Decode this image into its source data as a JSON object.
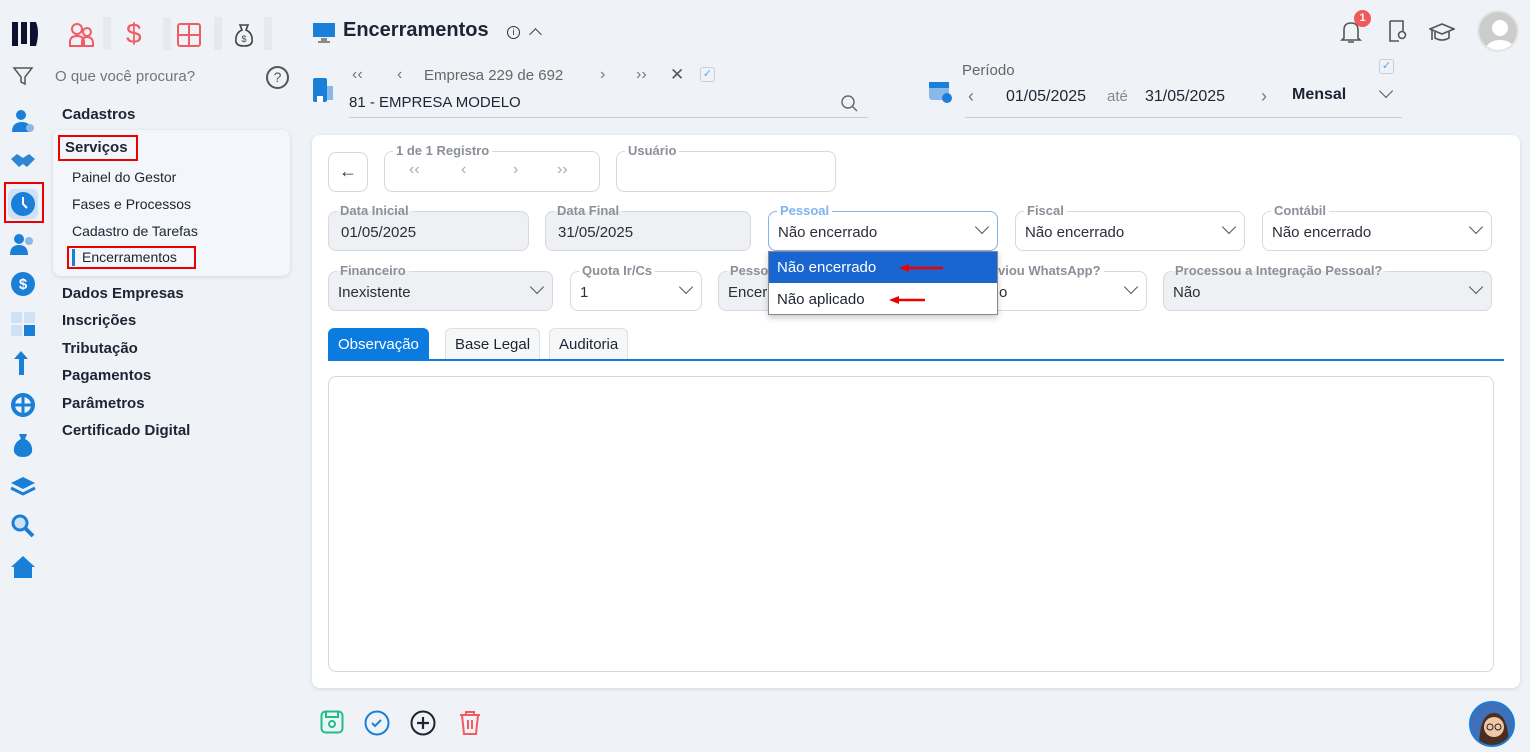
{
  "logo": "M",
  "top_shortcuts": [
    "people-icon",
    "dollar-icon",
    "calculator-icon",
    "money-bag-icon"
  ],
  "search": {
    "placeholder": "O que você procura?"
  },
  "menu": {
    "cadastros": "Cadastros",
    "servicos": "Serviços",
    "servicos_items": [
      "Painel do Gestor",
      "Fases e Processos",
      "Cadastro de Tarefas",
      "Encerramentos"
    ],
    "others": [
      "Dados Empresas",
      "Inscrições",
      "Tributação",
      "Pagamentos",
      "Parâmetros",
      "Certificado Digital"
    ]
  },
  "header": {
    "title": "Encerramentos",
    "notification_count": "1"
  },
  "empresa": {
    "nav_text": "Empresa 229 de 692",
    "value": "81 - EMPRESA MODELO"
  },
  "periodo": {
    "label": "Período",
    "start": "01/05/2025",
    "sep": "até",
    "end": "31/05/2025",
    "mode": "Mensal"
  },
  "record": {
    "label": "1 de 1 Registro",
    "user_label": "Usuário",
    "user_value": ""
  },
  "fields": {
    "data_inicial": {
      "label": "Data Inicial",
      "value": "01/05/2025"
    },
    "data_final": {
      "label": "Data Final",
      "value": "31/05/2025"
    },
    "pessoal": {
      "label": "Pessoal",
      "value": "Não encerrado"
    },
    "fiscal": {
      "label": "Fiscal",
      "value": "Não encerrado"
    },
    "contabil": {
      "label": "Contábil",
      "value": "Não encerrado"
    },
    "financeiro": {
      "label": "Financeiro",
      "value": "Inexistente"
    },
    "quota": {
      "label": "Quota Ir/Cs",
      "value": "1"
    },
    "hidden1": {
      "label": "Pesso",
      "value": "Encer"
    },
    "whatsapp": {
      "label": "viou WhatsApp?",
      "value": "o"
    },
    "integracao": {
      "label": "Processou a Integração Pessoal?",
      "value": "Não"
    }
  },
  "dropdown": {
    "options": [
      "Não encerrado",
      "Não aplicado"
    ],
    "selected": 0
  },
  "tabs": [
    "Observação",
    "Base Legal",
    "Auditoria"
  ],
  "colors": {
    "accent": "#0b7be0",
    "selected": "#1a66d1",
    "annotation": "#e00000"
  }
}
